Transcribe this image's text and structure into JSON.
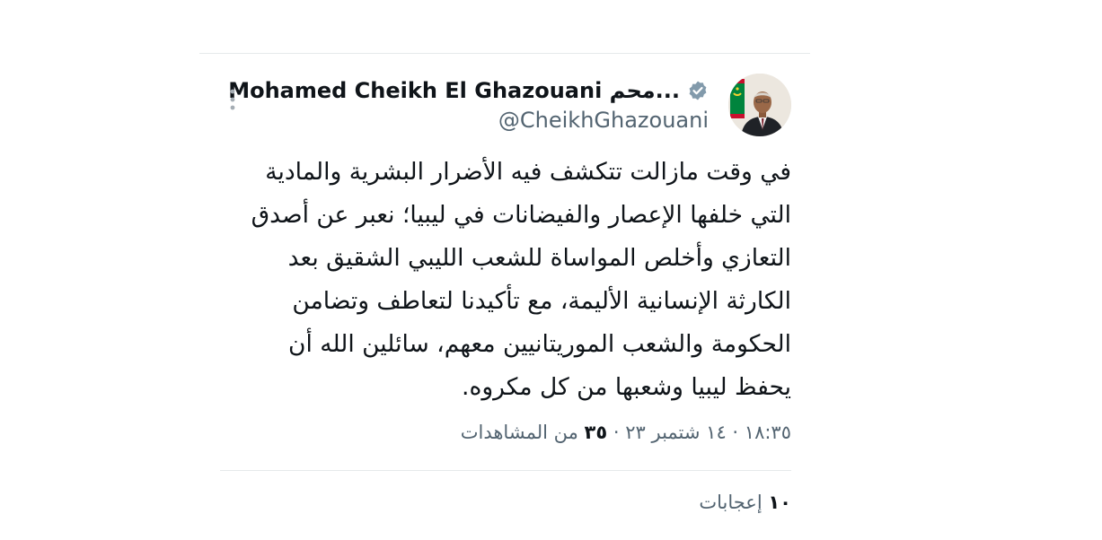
{
  "colors": {
    "text_primary": "#0f1419",
    "text_secondary": "#536471",
    "divider": "#e6e9eb",
    "verified_badge": "#829aab"
  },
  "tweet": {
    "author": {
      "display_name": "Mohamed Cheikh El Ghazouani محم...",
      "handle": "@CheikhGhazouani",
      "verified_icon": "verified-badge-icon",
      "avatar_icon": "profile-photo"
    },
    "more_icon": "more-vertical-icon",
    "text": "في وقت مازالت تتكشف فيه الأضرار البشرية والمادية\nالتي خلفها الإعصار والفيضانات في ليبيا؛ نعبر عن أصدق\nالتعازي وأخلص المواساة للشعب الليبي الشقيق بعد\nالكارثة الإنسانية الأليمة، مع تأكيدنا لتعاطف وتضامن\nالحكومة والشعب الموريتانيين معهم، سائلين الله أن\nيحفظ ليبيا وشعبها من كل مكروه.",
    "meta": {
      "time": "١٨:٣٥",
      "date": "١٤ شتمبر ٢٣",
      "separator": "·",
      "views_count": "٣٥",
      "views_label": "من المشاهدات"
    },
    "likes": {
      "count": "١٠",
      "label": "إعجابات"
    }
  }
}
